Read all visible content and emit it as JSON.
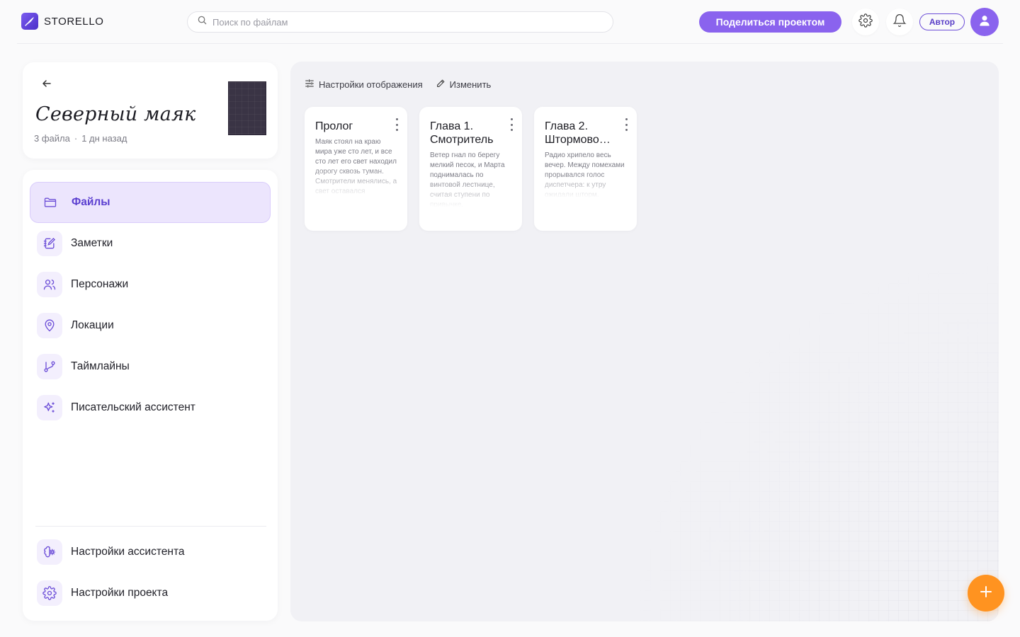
{
  "brand": {
    "name": "STORELLO",
    "icon": "quill-logo-icon",
    "color": "#6b4fe0"
  },
  "search": {
    "placeholder": "Поиск по файлам",
    "value": ""
  },
  "header": {
    "share_label": "Поделиться проектом",
    "role_label": "Автор",
    "settings_icon": "gear-icon",
    "notifications_icon": "bell-icon",
    "avatar_icon": "user-icon"
  },
  "project": {
    "title": "Северный маяк",
    "file_count": "3 файла",
    "separator": "·",
    "updated": "1 дн назад"
  },
  "nav": {
    "items": [
      {
        "label": "Файлы",
        "icon": "folder-icon",
        "active": true
      },
      {
        "label": "Заметки",
        "icon": "notebook-edit-icon",
        "active": false
      },
      {
        "label": "Персонажи",
        "icon": "users-icon",
        "active": false
      },
      {
        "label": "Локации",
        "icon": "map-pin-icon",
        "active": false
      },
      {
        "label": "Таймлайны",
        "icon": "git-branch-icon",
        "active": false
      },
      {
        "label": "Писательский ассистент",
        "icon": "sparkles-icon",
        "active": false
      }
    ],
    "bottom": [
      {
        "label": "Настройки ассистента",
        "icon": "brain-cog-icon"
      },
      {
        "label": "Настройки проекта",
        "icon": "gear-icon"
      }
    ]
  },
  "toolbar": {
    "display_settings": "Настройки отображения",
    "edit": "Изменить"
  },
  "files": [
    {
      "title": "Пролог",
      "excerpt": "Маяк стоял на краю мира уже сто лет, и все сто лет его свет находил дорогу сквозь туман. Смотрители менялись, а свет оставался прежним."
    },
    {
      "title": "Глава 1. Смотритель",
      "excerpt": "Ветер гнал по берегу мелкий песок, и Марта поднималась по винтовой лестнице, считая ступени по привычке."
    },
    {
      "title": "Глава 2. Штормово…",
      "excerpt": "Радио хрипело весь вечер. Между помехами прорывался голос диспетчера: к утру ожидали шторм."
    }
  ],
  "colors": {
    "accent": "#8a63ee",
    "fab": "#ff9320",
    "active_bg": "#ece5fd"
  },
  "fab_icon": "plus-icon"
}
